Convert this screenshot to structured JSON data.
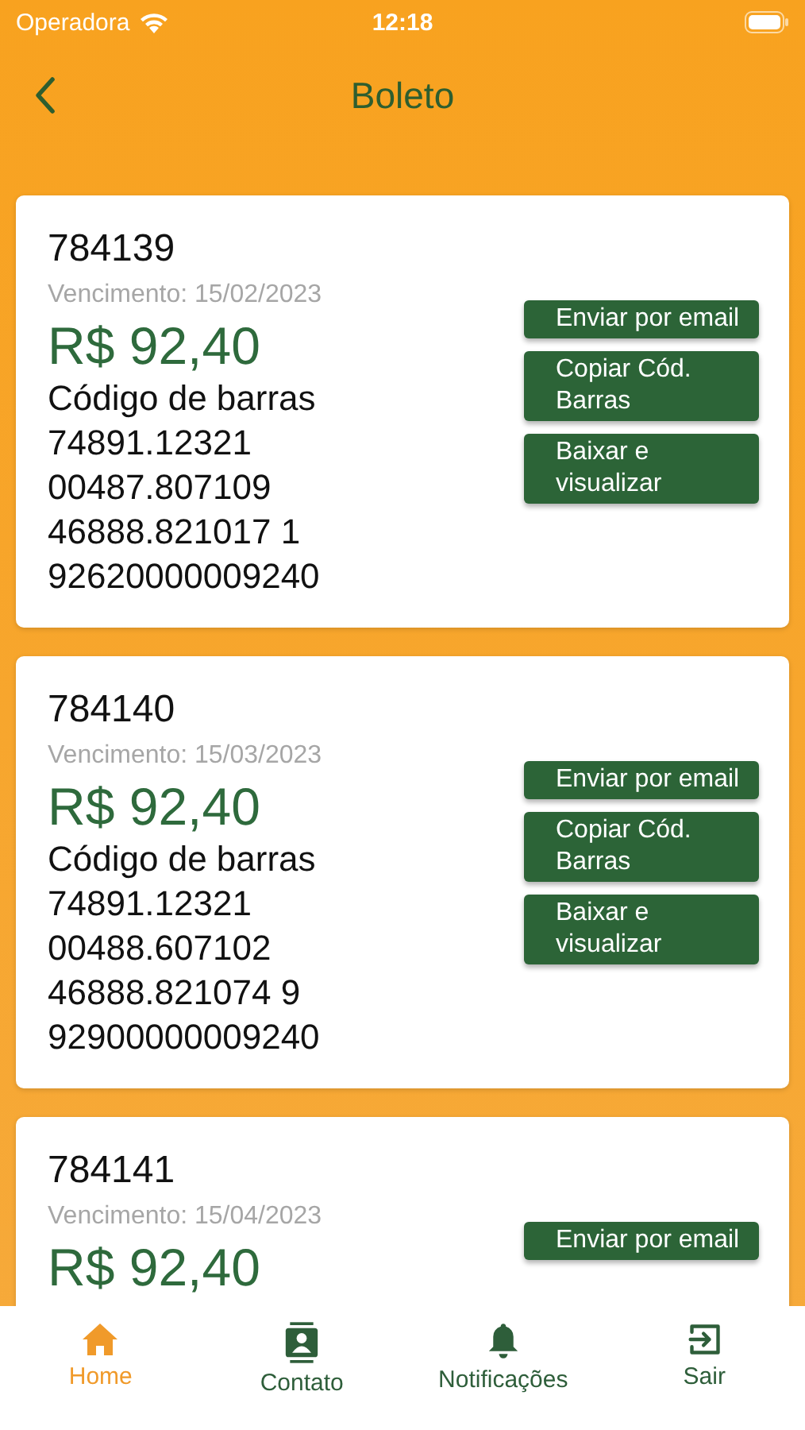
{
  "status_bar": {
    "carrier": "Operadora",
    "time": "12:18"
  },
  "nav": {
    "title": "Boleto"
  },
  "boletos": [
    {
      "number": "784139",
      "due": "Vencimento: 15/02/2023",
      "amount": "R$ 92,40",
      "barcode_label": "Código de barras",
      "barcode_lines": [
        "74891.12321",
        "00487.807109",
        "46888.821017 1",
        "92620000009240"
      ],
      "buttons": [
        "Enviar por email",
        "Copiar Cód. Barras",
        "Baixar e visualizar"
      ]
    },
    {
      "number": "784140",
      "due": "Vencimento: 15/03/2023",
      "amount": "R$ 92,40",
      "barcode_label": "Código de barras",
      "barcode_lines": [
        "74891.12321",
        "00488.607102",
        "46888.821074 9",
        "92900000009240"
      ],
      "buttons": [
        "Enviar por email",
        "Copiar Cód. Barras",
        "Baixar e visualizar"
      ]
    },
    {
      "number": "784141",
      "due": "Vencimento: 15/04/2023",
      "amount": "R$ 92,40",
      "buttons": [
        "Enviar por email"
      ]
    }
  ],
  "tab_bar": [
    {
      "label": "Home",
      "kind": "home",
      "selected": true
    },
    {
      "label": "Contato",
      "kind": "contact",
      "selected": false
    },
    {
      "label": "Notificações",
      "kind": "bell",
      "selected": false
    },
    {
      "label": "Sair",
      "kind": "exit",
      "selected": false
    }
  ]
}
